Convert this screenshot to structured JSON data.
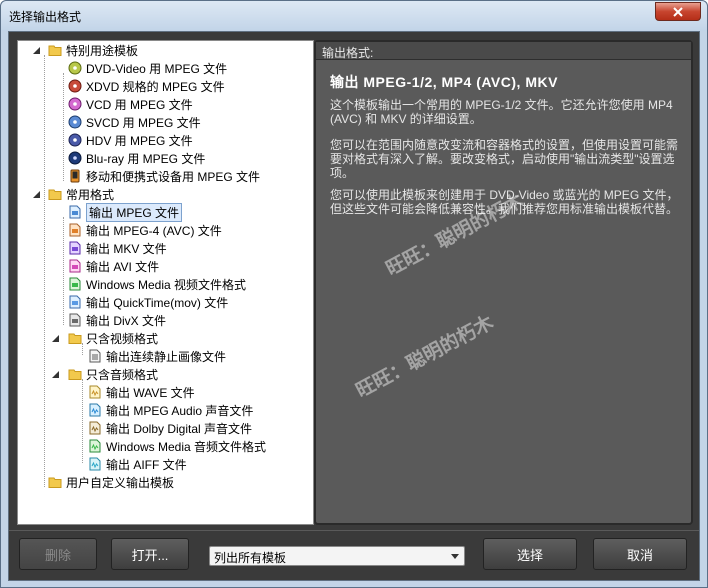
{
  "window": {
    "title": "选择输出格式"
  },
  "tree": {
    "groups": [
      {
        "label": "特别用途模板"
      },
      {
        "label": "常用格式"
      },
      {
        "label": "只含视频格式"
      },
      {
        "label": "只含音频格式"
      },
      {
        "label": "用户自定义输出模板"
      }
    ],
    "special": [
      "DVD-Video 用 MPEG 文件",
      "XDVD 规格的 MPEG 文件",
      "VCD 用 MPEG 文件",
      "SVCD 用 MPEG 文件",
      "HDV 用 MPEG 文件",
      "Blu-ray 用 MPEG 文件",
      "移动和便携式设备用 MPEG 文件"
    ],
    "common": [
      "输出 MPEG 文件",
      "输出 MPEG-4 (AVC) 文件",
      "输出 MKV 文件",
      "输出 AVI 文件",
      "Windows Media 视频文件格式",
      "输出 QuickTime(mov) 文件",
      "输出 DivX 文件"
    ],
    "video_only": [
      "输出连续静止画像文件"
    ],
    "audio_only": [
      "输出 WAVE 文件",
      "输出 MPEG Audio 声音文件",
      "输出 Dolby Digital 声音文件",
      "Windows Media 音频文件格式",
      "输出 AIFF 文件"
    ],
    "selected": "输出 MPEG 文件"
  },
  "info": {
    "header": "输出格式:",
    "title": "输出 MPEG-1/2, MP4 (AVC), MKV",
    "paragraphs": [
      "这个模板输出一个常用的 MPEG-1/2 文件。它还允许您使用 MP4 (AVC) 和 MKV 的详细设置。",
      "您可以在范围内随意改变流和容器格式的设置，但使用设置可能需要对格式有深入了解。要改变格式，启动使用\"输出流类型\"设置选项。",
      "您可以使用此模板来创建用于 DVD-Video 或蓝光的 MPEG 文件，但这些文件可能会降低兼容性。我们推荐您用标准输出模板代替。"
    ],
    "watermark": "旺旺：聪明的朽木"
  },
  "buttons": {
    "delete": "删除",
    "open": "打开...",
    "select": "选择",
    "cancel": "取消"
  },
  "filter": {
    "selected": "列出所有模板"
  },
  "colors": {
    "panel": "#5a5a5a",
    "client": "#3a3a3a",
    "folder": "#f2c94c",
    "selection": "#dceafc"
  }
}
